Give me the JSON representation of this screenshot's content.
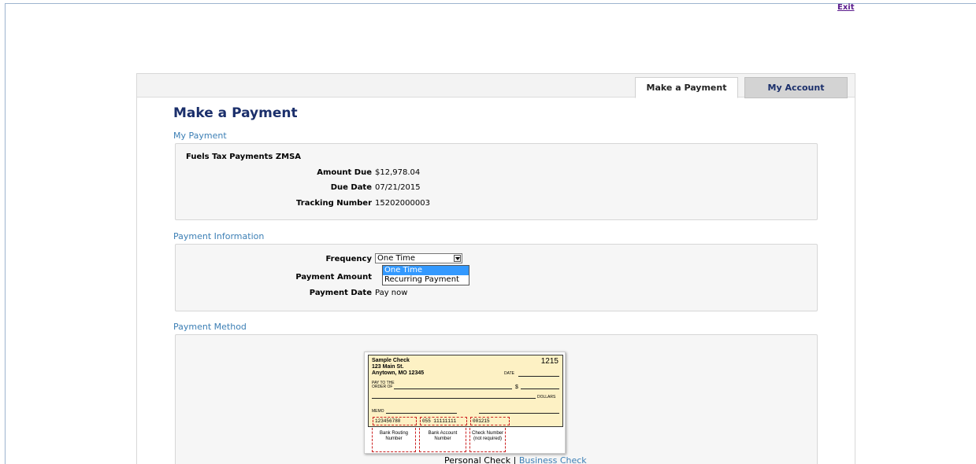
{
  "header": {
    "exit_label": "Exit"
  },
  "tabs": [
    {
      "label": "Make a Payment",
      "active": true
    },
    {
      "label": "My Account",
      "active": false
    }
  ],
  "page_title": "Make a Payment",
  "my_payment": {
    "section_title": "My Payment",
    "payee": "Fuels Tax Payments ZMSA",
    "amount_due_label": "Amount Due",
    "amount_due": "$12,978.04",
    "due_date_label": "Due Date",
    "due_date": "07/21/2015",
    "tracking_label": "Tracking Number",
    "tracking_number": "15202000003"
  },
  "payment_info": {
    "section_title": "Payment Information",
    "frequency_label": "Frequency",
    "frequency_value": "One Time",
    "frequency_options": [
      "One Time",
      "Recurring Payment"
    ],
    "amount_label": "Payment Amount",
    "date_label": "Payment Date",
    "date_value": "Pay now"
  },
  "payment_method": {
    "section_title": "Payment Method",
    "check": {
      "name_line1": "Sample Check",
      "name_line2": "123 Main St.",
      "name_line3": "Anytown, MO 12345",
      "number": "1215",
      "date_label": "DATE",
      "pay_to_label1": "PAY TO THE",
      "pay_to_label2": "ORDER OF",
      "dollar_sign": "$",
      "dollars_label": "DOLLARS",
      "memo_label": "MEMO",
      "routing_micr": "123456780",
      "account_micr": "055 11111111",
      "check_micr": "001215",
      "routing_caption": "Bank Routing Number",
      "account_caption": "Bank Account Number",
      "check_caption": "Check Number (not required)"
    },
    "personal_check_label": "Personal Check",
    "separator": "|",
    "business_check_label": "Business Check"
  },
  "colors": {
    "title": "#1b2f6b",
    "section": "#3c7fb5",
    "panel_bg": "#f6f6f6",
    "dropdown_highlight": "#3399ff",
    "check_bg": "#fdf1c4"
  }
}
